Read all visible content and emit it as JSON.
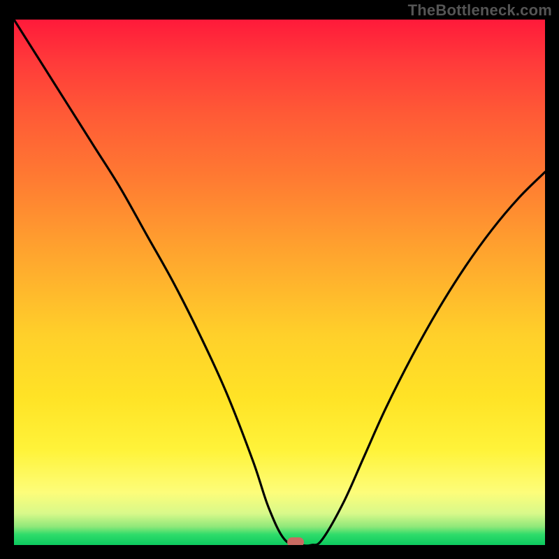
{
  "attribution": "TheBottleneck.com",
  "colors": {
    "frame": "#000000",
    "curve": "#000000",
    "marker": "#c96a62",
    "gradient_top": "#ff1a3a",
    "gradient_bottom": "#0cc95f"
  },
  "chart_data": {
    "type": "line",
    "title": "",
    "xlabel": "",
    "ylabel": "",
    "xlim": [
      0,
      100
    ],
    "ylim": [
      0,
      100
    ],
    "grid": false,
    "legend": false,
    "annotations": [],
    "series": [
      {
        "name": "bottleneck-curve",
        "x": [
          0,
          5,
          10,
          15,
          20,
          25,
          30,
          35,
          40,
          45,
          48,
          51,
          54,
          56,
          58,
          62,
          66,
          70,
          75,
          80,
          85,
          90,
          95,
          100
        ],
        "values": [
          100,
          92,
          84,
          76,
          68,
          59,
          50,
          40,
          29,
          16,
          7,
          1,
          0,
          0,
          1,
          8,
          17,
          26,
          36,
          45,
          53,
          60,
          66,
          71
        ]
      }
    ],
    "marker": {
      "x": 53,
      "y": 0
    },
    "background_gradient": {
      "direction": "vertical",
      "stops": [
        {
          "pos": 0.0,
          "color": "#ff1a3a"
        },
        {
          "pos": 0.3,
          "color": "#ff7a32"
        },
        {
          "pos": 0.6,
          "color": "#ffd02a"
        },
        {
          "pos": 0.9,
          "color": "#fdfd7a"
        },
        {
          "pos": 1.0,
          "color": "#0cc95f"
        }
      ]
    }
  }
}
